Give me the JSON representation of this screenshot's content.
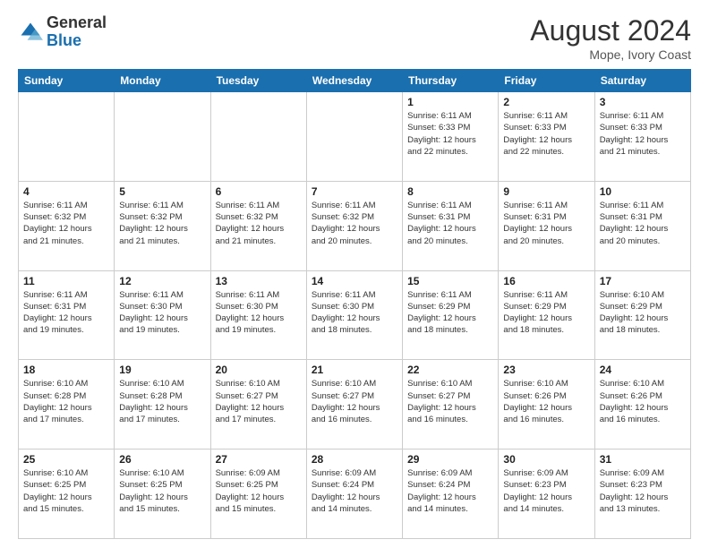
{
  "header": {
    "logo_general": "General",
    "logo_blue": "Blue",
    "month_year": "August 2024",
    "location": "Mope, Ivory Coast"
  },
  "days_of_week": [
    "Sunday",
    "Monday",
    "Tuesday",
    "Wednesday",
    "Thursday",
    "Friday",
    "Saturday"
  ],
  "weeks": [
    [
      {
        "day": "",
        "info": ""
      },
      {
        "day": "",
        "info": ""
      },
      {
        "day": "",
        "info": ""
      },
      {
        "day": "",
        "info": ""
      },
      {
        "day": "1",
        "info": "Sunrise: 6:11 AM\nSunset: 6:33 PM\nDaylight: 12 hours\nand 22 minutes."
      },
      {
        "day": "2",
        "info": "Sunrise: 6:11 AM\nSunset: 6:33 PM\nDaylight: 12 hours\nand 22 minutes."
      },
      {
        "day": "3",
        "info": "Sunrise: 6:11 AM\nSunset: 6:33 PM\nDaylight: 12 hours\nand 21 minutes."
      }
    ],
    [
      {
        "day": "4",
        "info": "Sunrise: 6:11 AM\nSunset: 6:32 PM\nDaylight: 12 hours\nand 21 minutes."
      },
      {
        "day": "5",
        "info": "Sunrise: 6:11 AM\nSunset: 6:32 PM\nDaylight: 12 hours\nand 21 minutes."
      },
      {
        "day": "6",
        "info": "Sunrise: 6:11 AM\nSunset: 6:32 PM\nDaylight: 12 hours\nand 21 minutes."
      },
      {
        "day": "7",
        "info": "Sunrise: 6:11 AM\nSunset: 6:32 PM\nDaylight: 12 hours\nand 20 minutes."
      },
      {
        "day": "8",
        "info": "Sunrise: 6:11 AM\nSunset: 6:31 PM\nDaylight: 12 hours\nand 20 minutes."
      },
      {
        "day": "9",
        "info": "Sunrise: 6:11 AM\nSunset: 6:31 PM\nDaylight: 12 hours\nand 20 minutes."
      },
      {
        "day": "10",
        "info": "Sunrise: 6:11 AM\nSunset: 6:31 PM\nDaylight: 12 hours\nand 20 minutes."
      }
    ],
    [
      {
        "day": "11",
        "info": "Sunrise: 6:11 AM\nSunset: 6:31 PM\nDaylight: 12 hours\nand 19 minutes."
      },
      {
        "day": "12",
        "info": "Sunrise: 6:11 AM\nSunset: 6:30 PM\nDaylight: 12 hours\nand 19 minutes."
      },
      {
        "day": "13",
        "info": "Sunrise: 6:11 AM\nSunset: 6:30 PM\nDaylight: 12 hours\nand 19 minutes."
      },
      {
        "day": "14",
        "info": "Sunrise: 6:11 AM\nSunset: 6:30 PM\nDaylight: 12 hours\nand 18 minutes."
      },
      {
        "day": "15",
        "info": "Sunrise: 6:11 AM\nSunset: 6:29 PM\nDaylight: 12 hours\nand 18 minutes."
      },
      {
        "day": "16",
        "info": "Sunrise: 6:11 AM\nSunset: 6:29 PM\nDaylight: 12 hours\nand 18 minutes."
      },
      {
        "day": "17",
        "info": "Sunrise: 6:10 AM\nSunset: 6:29 PM\nDaylight: 12 hours\nand 18 minutes."
      }
    ],
    [
      {
        "day": "18",
        "info": "Sunrise: 6:10 AM\nSunset: 6:28 PM\nDaylight: 12 hours\nand 17 minutes."
      },
      {
        "day": "19",
        "info": "Sunrise: 6:10 AM\nSunset: 6:28 PM\nDaylight: 12 hours\nand 17 minutes."
      },
      {
        "day": "20",
        "info": "Sunrise: 6:10 AM\nSunset: 6:27 PM\nDaylight: 12 hours\nand 17 minutes."
      },
      {
        "day": "21",
        "info": "Sunrise: 6:10 AM\nSunset: 6:27 PM\nDaylight: 12 hours\nand 16 minutes."
      },
      {
        "day": "22",
        "info": "Sunrise: 6:10 AM\nSunset: 6:27 PM\nDaylight: 12 hours\nand 16 minutes."
      },
      {
        "day": "23",
        "info": "Sunrise: 6:10 AM\nSunset: 6:26 PM\nDaylight: 12 hours\nand 16 minutes."
      },
      {
        "day": "24",
        "info": "Sunrise: 6:10 AM\nSunset: 6:26 PM\nDaylight: 12 hours\nand 16 minutes."
      }
    ],
    [
      {
        "day": "25",
        "info": "Sunrise: 6:10 AM\nSunset: 6:25 PM\nDaylight: 12 hours\nand 15 minutes."
      },
      {
        "day": "26",
        "info": "Sunrise: 6:10 AM\nSunset: 6:25 PM\nDaylight: 12 hours\nand 15 minutes."
      },
      {
        "day": "27",
        "info": "Sunrise: 6:09 AM\nSunset: 6:25 PM\nDaylight: 12 hours\nand 15 minutes."
      },
      {
        "day": "28",
        "info": "Sunrise: 6:09 AM\nSunset: 6:24 PM\nDaylight: 12 hours\nand 14 minutes."
      },
      {
        "day": "29",
        "info": "Sunrise: 6:09 AM\nSunset: 6:24 PM\nDaylight: 12 hours\nand 14 minutes."
      },
      {
        "day": "30",
        "info": "Sunrise: 6:09 AM\nSunset: 6:23 PM\nDaylight: 12 hours\nand 14 minutes."
      },
      {
        "day": "31",
        "info": "Sunrise: 6:09 AM\nSunset: 6:23 PM\nDaylight: 12 hours\nand 13 minutes."
      }
    ]
  ]
}
